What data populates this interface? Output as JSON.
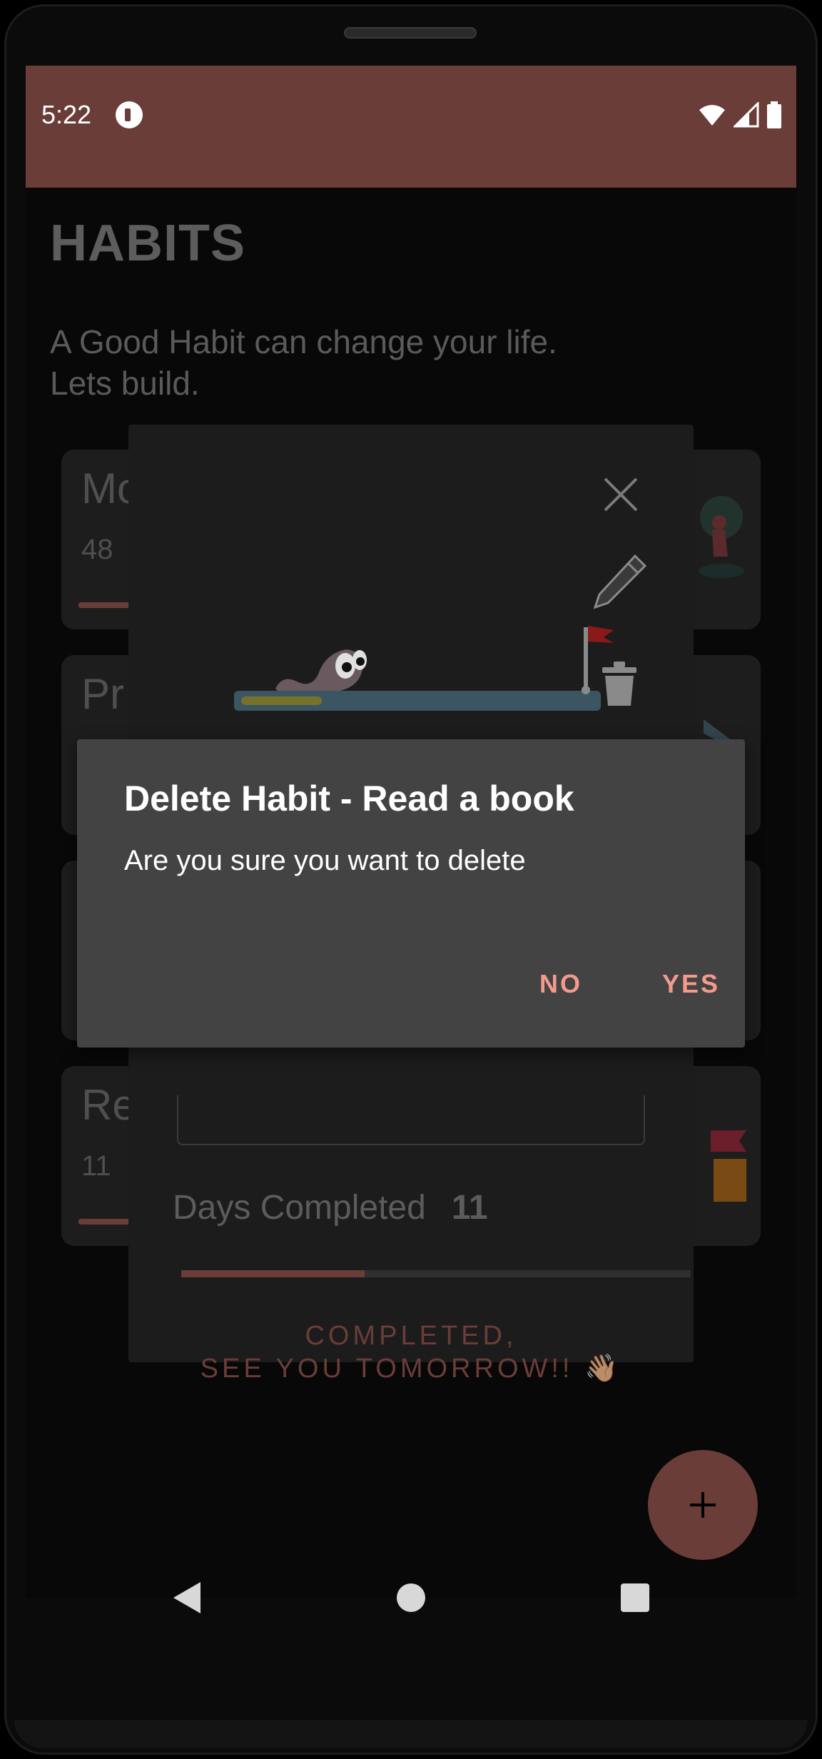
{
  "status_bar": {
    "time": "5:22"
  },
  "header": {
    "title": "HABITS",
    "subtitle_line1": "A Good Habit can change your life.",
    "subtitle_line2": "Lets build."
  },
  "habit_cards": [
    {
      "title_partial": "Mo",
      "count": "48"
    },
    {
      "title_partial": "Pr",
      "count": ""
    },
    {
      "title_partial": "",
      "count": ""
    },
    {
      "title_partial": "Re",
      "count": "11"
    }
  ],
  "detail_sheet": {
    "days_label": "Days Completed",
    "days_value": "11",
    "progress_fraction": 0.36,
    "track_fraction": 0.22,
    "completed_line1": "COMPLETED,",
    "completed_line2": "SEE YOU TOMORROW!! 👋🏽"
  },
  "dialog": {
    "title": "Delete Habit - Read a book",
    "message": "Are you sure you want to delete",
    "no_label": "NO",
    "yes_label": "YES"
  },
  "fab": {
    "label": "+"
  },
  "icons": {
    "close": "close-icon",
    "edit": "pencil-icon",
    "delete": "trash-icon",
    "fab": "plus-icon"
  },
  "colors": {
    "accent": "#6b3d38",
    "dialog_button": "#f39a8c",
    "dialog_background": "#434343"
  }
}
